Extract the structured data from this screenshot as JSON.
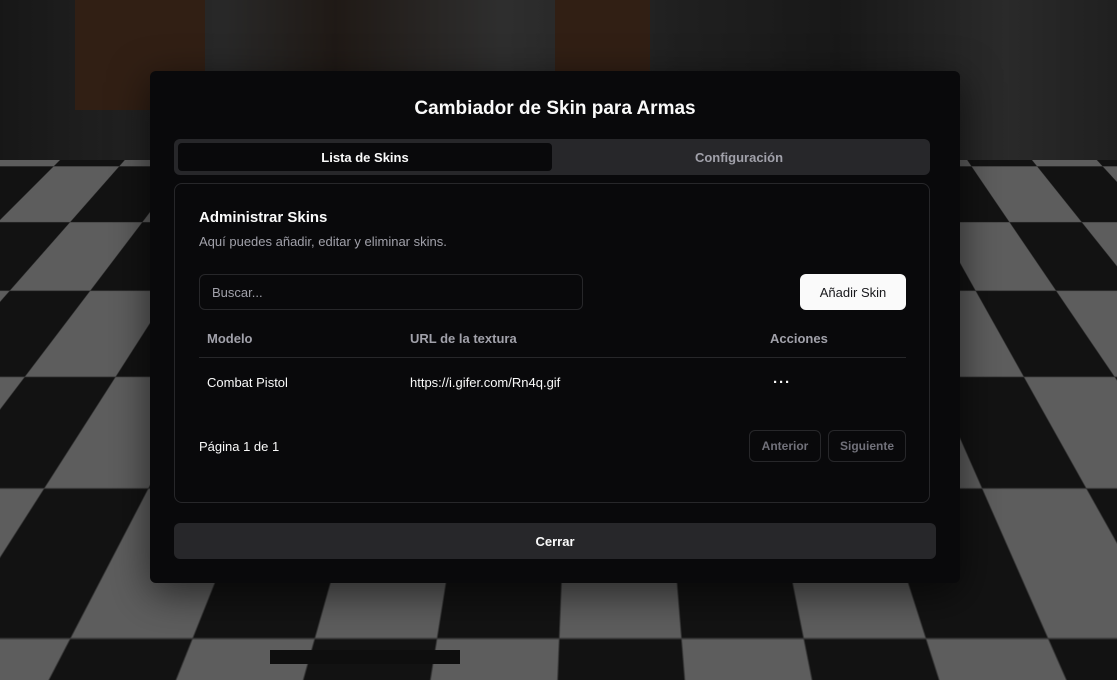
{
  "modal": {
    "title": "Cambiador de Skin para Armas",
    "tabs": [
      {
        "label": "Lista de Skins",
        "active": true
      },
      {
        "label": "Configuración",
        "active": false
      }
    ],
    "card": {
      "title": "Administrar Skins",
      "description": "Aquí puedes añadir, editar y eliminar skins."
    },
    "search": {
      "placeholder": "Buscar...",
      "value": ""
    },
    "add_button_label": "Añadir Skin",
    "table": {
      "headers": [
        "Modelo",
        "URL de la textura",
        "Acciones"
      ],
      "rows": [
        {
          "model": "Combat Pistol",
          "url": "https://i.gifer.com/Rn4q.gif",
          "actions": "···"
        }
      ]
    },
    "pagination": {
      "info": "Página 1 de 1",
      "prev_label": "Anterior",
      "next_label": "Siguiente"
    },
    "close_label": "Cerrar"
  },
  "colors": {
    "modal_bg": "#09090b",
    "border": "#27272a",
    "muted_text": "#a1a1aa",
    "primary_button_bg": "#fafafa"
  }
}
